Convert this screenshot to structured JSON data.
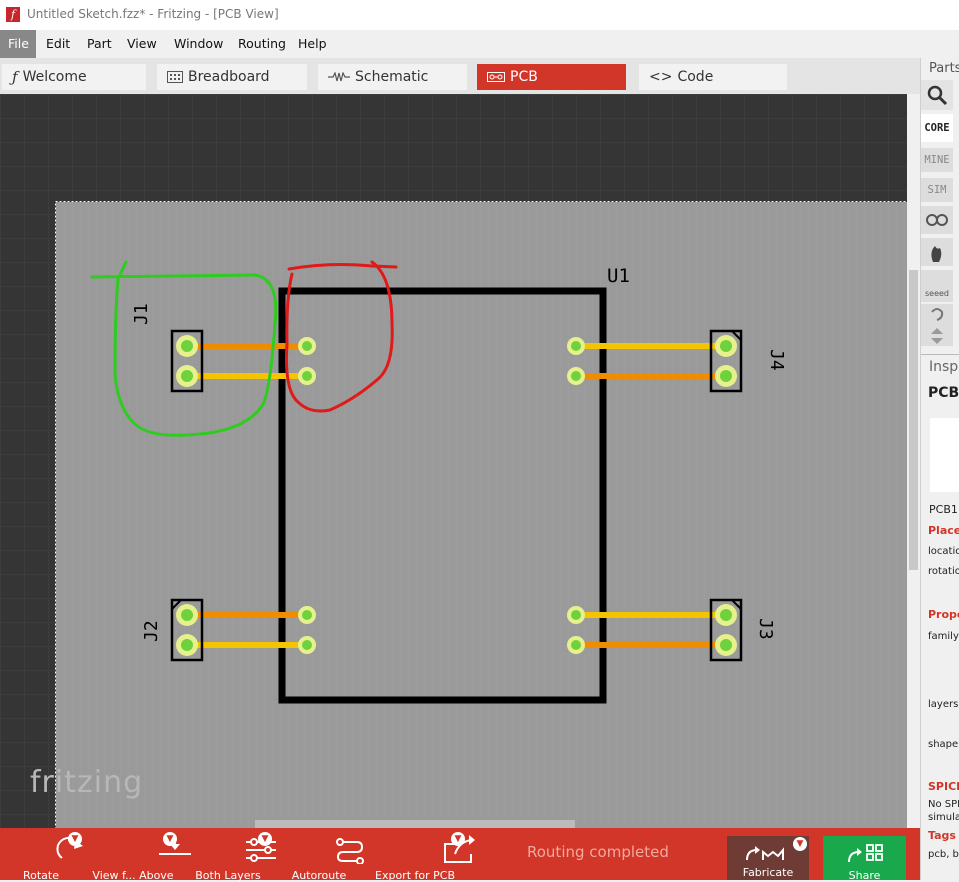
{
  "window": {
    "title": "Untitled Sketch.fzz* - Fritzing - [PCB View]",
    "app_icon": "f"
  },
  "menu": [
    "File",
    "Edit",
    "Part",
    "View",
    "Window",
    "Routing",
    "Help"
  ],
  "tabs": [
    {
      "label": "Welcome",
      "icon": "fritzing-logo-icon"
    },
    {
      "label": "Breadboard",
      "icon": "breadboard-icon"
    },
    {
      "label": "Schematic",
      "icon": "resistor-icon"
    },
    {
      "label": "PCB",
      "icon": "pcb-icon",
      "active": true
    },
    {
      "label": "Code",
      "icon": "code-brackets-icon"
    }
  ],
  "board": {
    "parts": {
      "u1": "U1",
      "j1": "J1",
      "j2": "J2",
      "j3": "J3",
      "j4": "J4"
    },
    "watermark": "fritzing"
  },
  "parts_panel": {
    "title": "Parts",
    "bins": [
      "CORE",
      "MINE",
      "SIM",
      "seeed"
    ]
  },
  "inspector": {
    "title": "Inspe",
    "part_title": "PCB1",
    "part_name": "PCB1",
    "placement_header": "Placem",
    "location_label": "location",
    "rotation_label": "rotation",
    "properties_header": "Prope",
    "family_label": "family",
    "layers_label": "layers",
    "shape_label": "shape",
    "spice_header": "SPICE",
    "spice_text_1": "No SPI",
    "spice_text_2": "simula",
    "tags_header": "Tags",
    "tags_text": "pcb, bo"
  },
  "toolbar": {
    "rotate": "Rotate",
    "view_from": "View f... Above",
    "layers": "Both Layers",
    "autoroute": "Autoroute",
    "export": "Export for PCB",
    "status": "Routing completed",
    "fabricate": "Fabricate",
    "share": "Share"
  },
  "colors": {
    "accent": "#d13628",
    "trace_orange": "#f08c00",
    "trace_yellow": "#f5c400",
    "pad_green": "#6ed23c",
    "board": "#9a9a9a",
    "annotation_green": "#2ecc1f",
    "annotation_red": "#e01919",
    "share_green": "#1aa84c"
  }
}
